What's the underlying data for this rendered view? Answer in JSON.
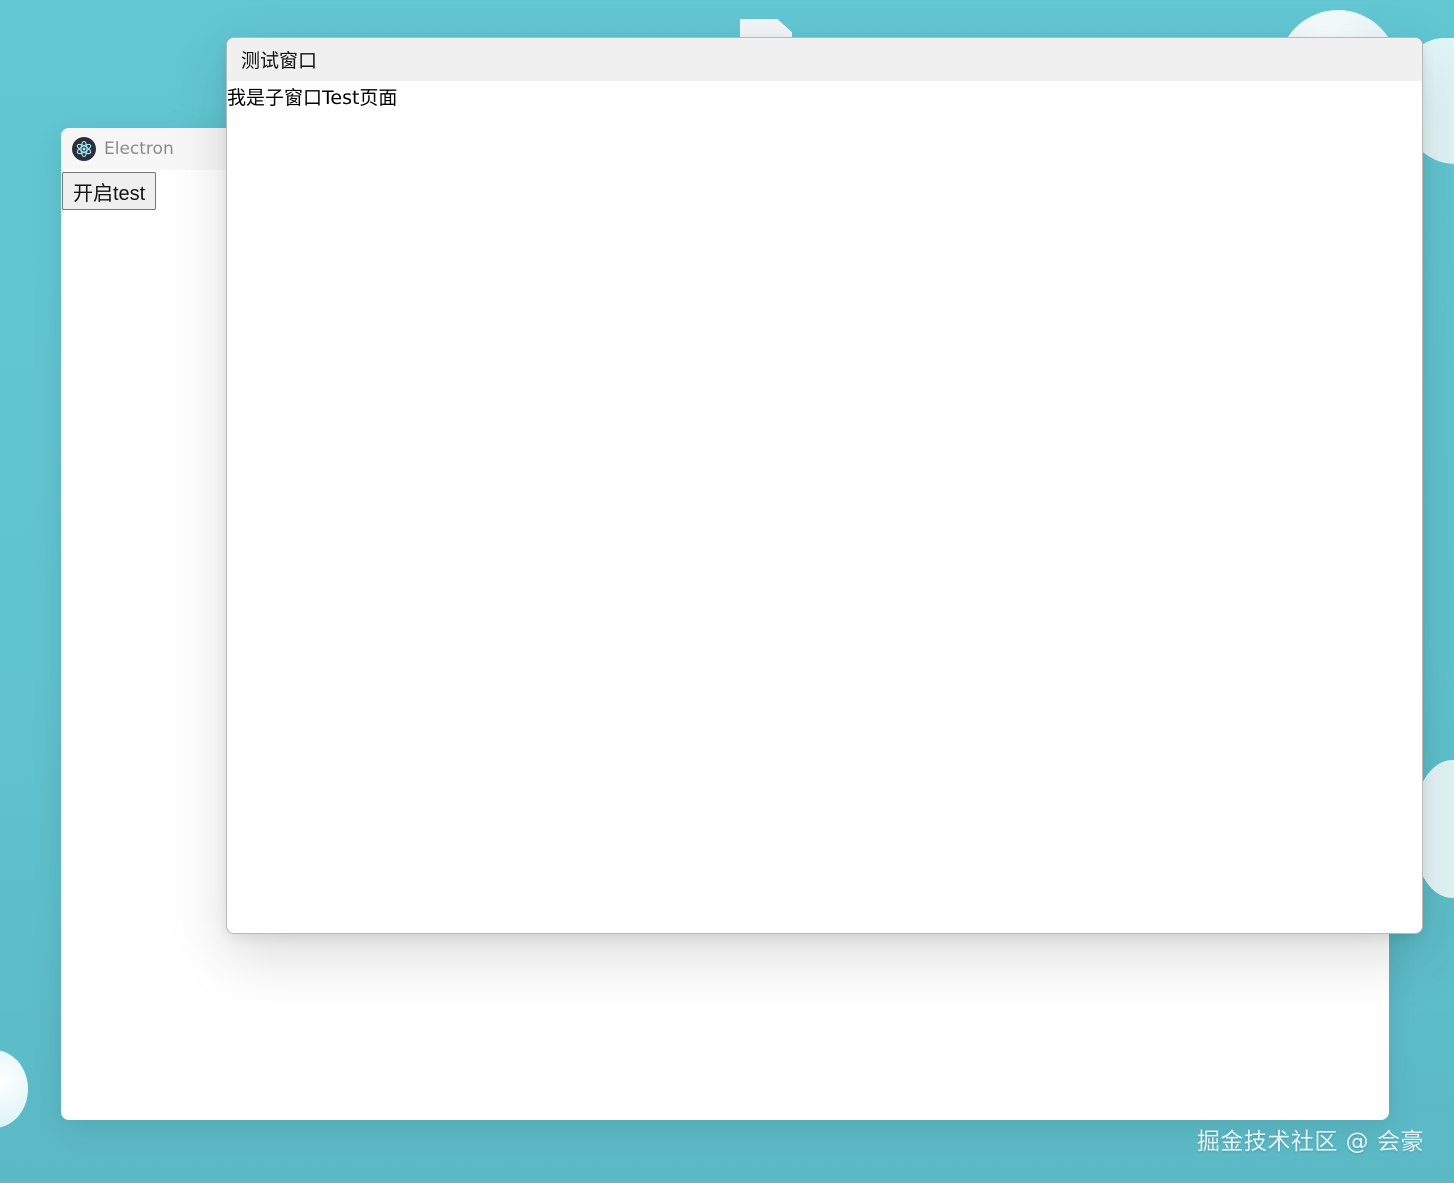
{
  "main_window": {
    "title": "Electron",
    "icon": "electron-logo-icon",
    "open_button_label": "开启test"
  },
  "child_window": {
    "title": "测试窗口",
    "page_text": "我是子窗口Test页面"
  },
  "watermark": {
    "text": "掘金技术社区 @ 会豪"
  },
  "colors": {
    "desktop_background": "#62c7d3",
    "titlebar_main": "#f7f7f7",
    "titlebar_child": "#f0f0f0",
    "button_background": "#efefef"
  }
}
